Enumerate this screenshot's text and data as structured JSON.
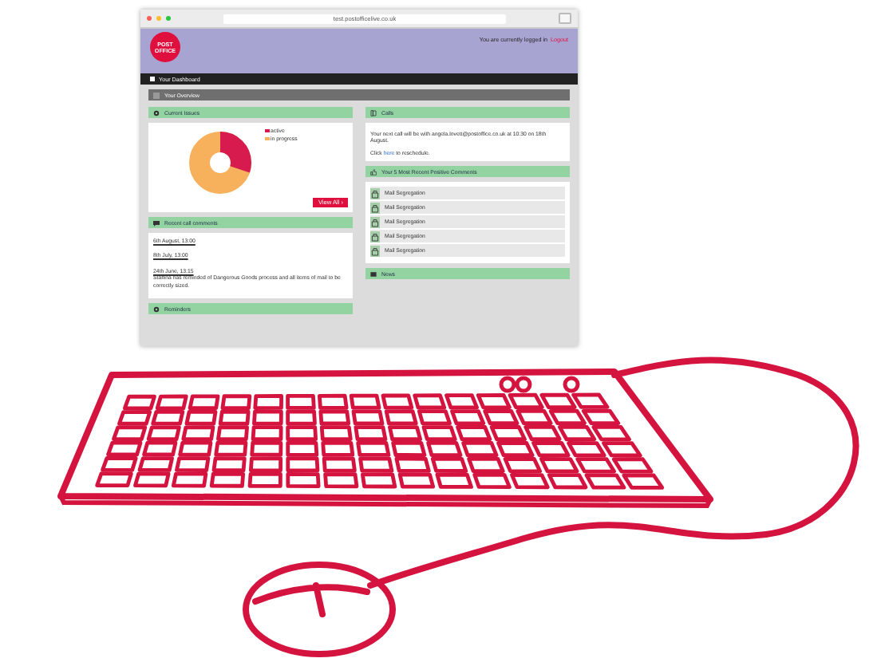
{
  "browser": {
    "url": "test.postofficelive.co.uk"
  },
  "header": {
    "logo_lines": [
      "POST",
      "OFFICE"
    ],
    "login_text": "You are currently logged in",
    "logout": "Logout"
  },
  "nav": {
    "item": "Your Dashboard"
  },
  "overview": {
    "title": "Your Overview"
  },
  "left": [
    {
      "kind": "issues",
      "title": "Current Issues",
      "legend": [
        {
          "label": "active",
          "color": "#d81b4f"
        },
        {
          "label": "in progress",
          "color": "#f7b05b"
        }
      ],
      "button": "View All ›"
    },
    {
      "kind": "comments",
      "title": "Recent call comments",
      "entries": [
        {
          "date": "6th August, 13:00"
        },
        {
          "date": "8th July, 13:00"
        },
        {
          "date": "24th June, 13:15",
          "text": "Staffina has reminded of Dangerous Goods process and all items of mail to be correctly sized."
        }
      ]
    },
    {
      "kind": "reminders",
      "title": "Reminders"
    }
  ],
  "right": [
    {
      "kind": "calls",
      "title": "Calls",
      "text": "Your next call will be with angela.lovett@postoffice.co.uk at 10:30 on 18th August.",
      "prompt": "Click",
      "link": "here",
      "after": "to reschedule."
    },
    {
      "kind": "list",
      "title": "Your 5 Most Recent Positive Comments",
      "items": [
        "Mail Segregation",
        "Mail Segregation",
        "Mail Segregation",
        "Mail Segregation",
        "Mail Segregation"
      ]
    },
    {
      "kind": "news",
      "title": "News"
    }
  ]
}
